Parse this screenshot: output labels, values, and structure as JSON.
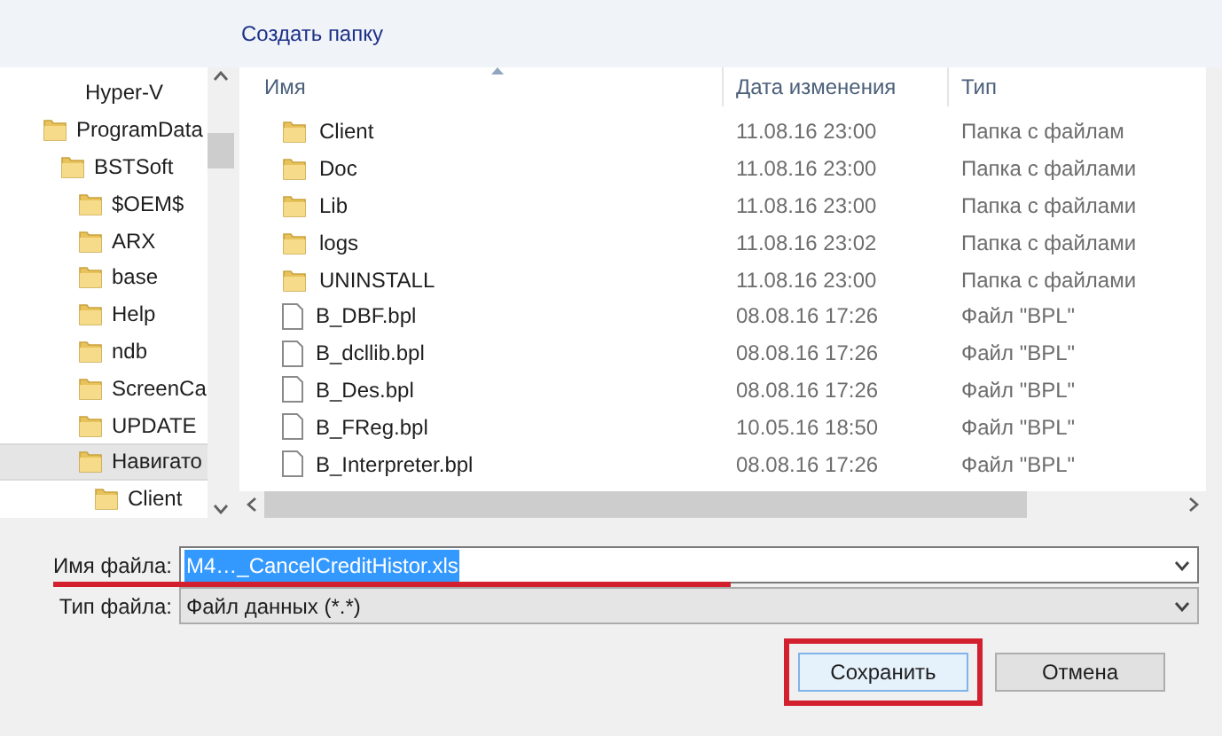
{
  "toolbar": {
    "new_folder": "Создать папку"
  },
  "tree": [
    {
      "label": "Hyper-V",
      "icon": false,
      "selected": false
    },
    {
      "label": "ProgramData",
      "icon": true,
      "selected": false,
      "children": [
        {
          "label": "BSTSoft",
          "icon": true,
          "selected": false,
          "children": [
            {
              "label": "$OEM$",
              "icon": true,
              "selected": false
            },
            {
              "label": "ARX",
              "icon": true,
              "selected": false
            },
            {
              "label": "base",
              "icon": true,
              "selected": false
            },
            {
              "label": "Help",
              "icon": true,
              "selected": false
            },
            {
              "label": "ndb",
              "icon": true,
              "selected": false
            },
            {
              "label": "ScreenCa",
              "icon": true,
              "selected": false
            },
            {
              "label": "UPDATE",
              "icon": true,
              "selected": false
            },
            {
              "label": "Навигато",
              "icon": true,
              "selected": true,
              "children": [
                {
                  "label": "Client",
                  "icon": true,
                  "selected": false
                }
              ]
            }
          ]
        }
      ]
    }
  ],
  "table": {
    "columns": [
      "Имя",
      "Дата изменения",
      "Тип"
    ],
    "rows": [
      {
        "kind": "folder",
        "name": "Client",
        "date": "11.08.16 23:00",
        "type": "Папка с файлам"
      },
      {
        "kind": "folder",
        "name": "Doc",
        "date": "11.08.16 23:00",
        "type": "Папка с файлами"
      },
      {
        "kind": "folder",
        "name": "Lib",
        "date": "11.08.16 23:00",
        "type": "Папка с файлами"
      },
      {
        "kind": "folder",
        "name": "logs",
        "date": "11.08.16 23:02",
        "type": "Папка с файлами"
      },
      {
        "kind": "folder",
        "name": "UNINSTALL",
        "date": "11.08.16 23:00",
        "type": "Папка с файлами"
      },
      {
        "kind": "file",
        "name": "B_DBF.bpl",
        "date": "08.08.16 17:26",
        "type": "Файл \"BPL\""
      },
      {
        "kind": "file",
        "name": "B_dcllib.bpl",
        "date": "08.08.16 17:26",
        "type": "Файл \"BPL\""
      },
      {
        "kind": "file",
        "name": "B_Des.bpl",
        "date": "08.08.16 17:26",
        "type": "Файл \"BPL\""
      },
      {
        "kind": "file",
        "name": "B_FReg.bpl",
        "date": "10.05.16 18:50",
        "type": "Файл \"BPL\""
      },
      {
        "kind": "file",
        "name": "B_Interpreter.bpl",
        "date": "08.08.16 17:26",
        "type": "Файл \"BPL\""
      }
    ]
  },
  "file_name": {
    "label": "Имя файла:",
    "value": "M4…_CancelCreditHistor.xls"
  },
  "file_type": {
    "label": "Тип файла:",
    "value": "Файл данных (*.*)"
  },
  "buttons": [
    {
      "label": "Сохранить",
      "highlighted": true
    },
    {
      "label": "Отмена",
      "highlighted": false
    }
  ]
}
